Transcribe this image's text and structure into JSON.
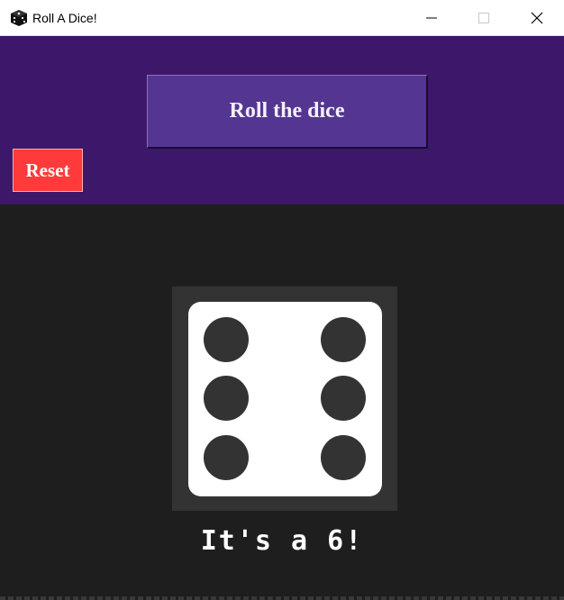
{
  "window": {
    "title": "Roll A Dice!",
    "app_icon": "dice-icon",
    "controls": [
      "minimize-icon",
      "maximize-icon",
      "close-icon"
    ]
  },
  "controls": {
    "roll_label": "Roll the dice",
    "reset_label": "Reset"
  },
  "dice": {
    "value": 6,
    "result_text": "It's a 6!"
  },
  "colors": {
    "top_panel": "#3d176a",
    "roll_button": "#553592",
    "reset_button": "#ff3a3a",
    "background": "#1e1e1e",
    "dice_frame": "#333333",
    "dice_face": "#ffffff",
    "pip": "#333333"
  }
}
